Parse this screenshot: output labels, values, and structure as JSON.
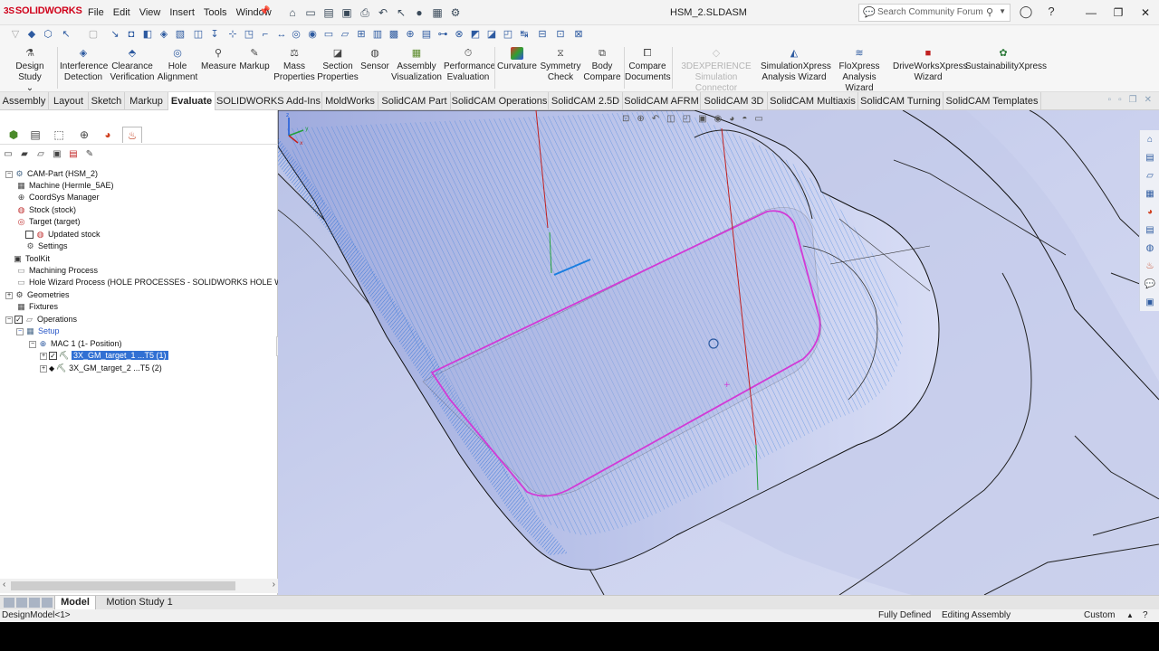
{
  "app": {
    "logo_ds": "3S",
    "logo_text": "SOLIDWORKS",
    "title": "HSM_2.SLDASM",
    "search_placeholder": "Search Community Forum",
    "menu": [
      "File",
      "Edit",
      "View",
      "Insert",
      "Tools",
      "Window"
    ]
  },
  "command_manager": {
    "design_study": "Design Study",
    "interference": [
      "Interference",
      "Detection"
    ],
    "clearance": [
      "Clearance",
      "Verification"
    ],
    "hole_alignment": [
      "Hole",
      "Alignment"
    ],
    "measure": "Measure",
    "markup": "Markup",
    "mass": [
      "Mass",
      "Properties"
    ],
    "section": [
      "Section",
      "Properties"
    ],
    "sensor": "Sensor",
    "assembly_vis": [
      "Assembly",
      "Visualization"
    ],
    "performance": [
      "Performance",
      "Evaluation"
    ],
    "curvature": "Curvature",
    "symmetry": [
      "Symmetry",
      "Check"
    ],
    "body_compare": [
      "Body",
      "Compare"
    ],
    "compare_docs": [
      "Compare",
      "Documents"
    ],
    "experience": [
      "3DEXPERIENCE",
      "Simulation Connector"
    ],
    "simxpress": [
      "SimulationXpress",
      "Analysis Wizard"
    ],
    "floxpress": [
      "FloXpress",
      "Analysis Wizard"
    ],
    "driveworks": [
      "DriveWorksXpress",
      "Wizard"
    ],
    "sustainability": "SustainabilityXpress"
  },
  "tabs": [
    "Assembly",
    "Layout",
    "Sketch",
    "Markup",
    "Evaluate",
    "SOLIDWORKS Add-Ins",
    "MoldWorks",
    "SolidCAM Part",
    "SolidCAM Operations",
    "SolidCAM 2.5D",
    "SolidCAM AFRM",
    "SolidCAM 3D",
    "SolidCAM Multiaxis",
    "SolidCAM Turning",
    "SolidCAM Templates"
  ],
  "active_tab": "Evaluate",
  "tree": {
    "cam_part": "CAM-Part (HSM_2)",
    "machine": "Machine (Hermle_5AE)",
    "coordsys": "CoordSys Manager",
    "stock": "Stock (stock)",
    "target": "Target (target)",
    "updated_stock": "Updated stock",
    "settings": "Settings",
    "toolkit": "ToolKit",
    "machining_process": "Machining Process",
    "hole_wizard": "Hole Wizard Process (HOLE PROCESSES - SOLIDWORKS HOLE WIZARD",
    "geometries": "Geometries",
    "fixtures": "Fixtures",
    "operations": "Operations",
    "setup": "Setup",
    "mac1": "MAC 1 (1- Position)",
    "op1": "3X_GM_target_1 ...T5 (1)",
    "op2": "3X_GM_target_2 ...T5 (2)"
  },
  "bottom_tabs": [
    "Model",
    "Motion Study 1"
  ],
  "status": {
    "left": "DesignModel<1>",
    "defined": "Fully Defined",
    "editing": "Editing Assembly",
    "units": "Custom"
  },
  "colors": {
    "accent": "#3170d3",
    "viewport_bg": "#c6cdea",
    "toolpath": "#1a6fd8",
    "boundary": "#d23ad6"
  }
}
